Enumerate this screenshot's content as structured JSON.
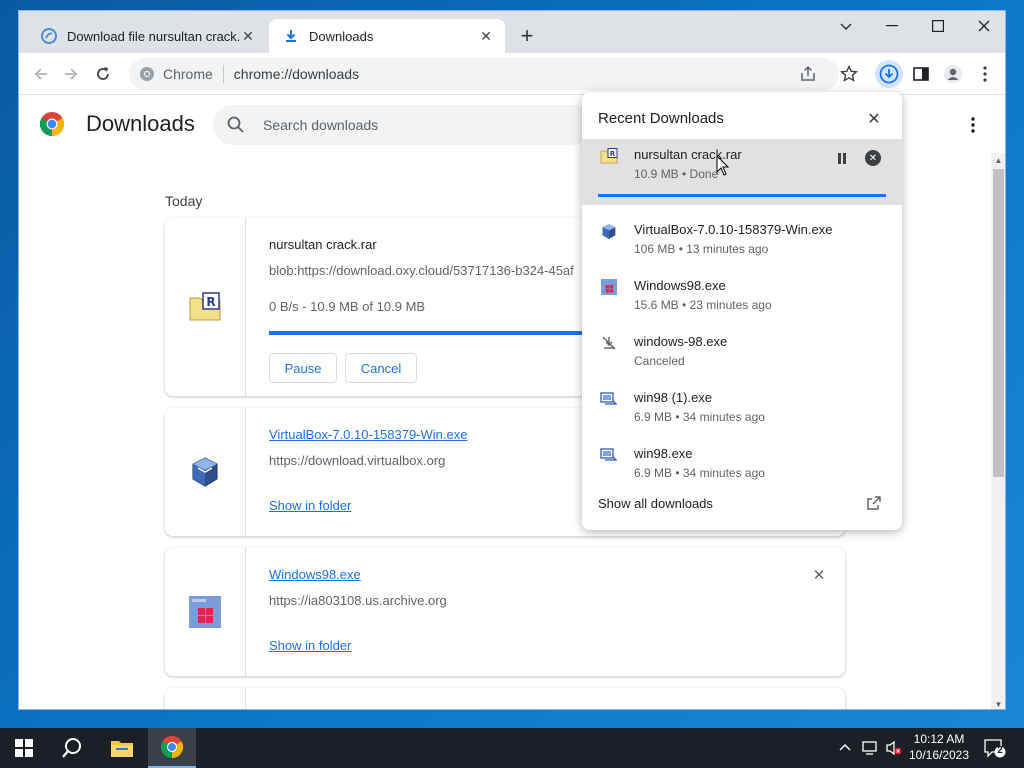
{
  "browser": {
    "tabs": [
      {
        "title": "Download file nursultan crack.ra",
        "active": false
      },
      {
        "title": "Downloads",
        "active": true
      }
    ],
    "new_tab_label": "+",
    "omnibox": {
      "site_label": "Chrome",
      "url": "chrome://downloads"
    }
  },
  "page": {
    "title": "Downloads",
    "search_placeholder": "Search downloads",
    "section_label": "Today",
    "items": [
      {
        "name": "nursultan crack.rar",
        "source": "blob:https://download.oxy.cloud/53717136-b324-45af",
        "status": "0 B/s - 10.9 MB of 10.9 MB",
        "progress_fraction": 1.0,
        "pause_label": "Pause",
        "cancel_label": "Cancel"
      },
      {
        "name": "VirtualBox-7.0.10-158379-Win.exe",
        "source": "https://download.virtualbox.org",
        "show_in_folder_label": "Show in folder"
      },
      {
        "name": "Windows98.exe",
        "source": "https://ia803108.us.archive.org",
        "show_in_folder_label": "Show in folder"
      }
    ]
  },
  "bubble": {
    "title": "Recent Downloads",
    "items": [
      {
        "name": "nursultan crack.rar",
        "meta": "10.9 MB • Done",
        "progress_fraction": 1.0
      },
      {
        "name": "VirtualBox-7.0.10-158379-Win.exe",
        "meta": "106 MB • 13 minutes ago"
      },
      {
        "name": "Windows98.exe",
        "meta": "15.6 MB • 23 minutes ago"
      },
      {
        "name": "windows-98.exe",
        "meta": "Canceled"
      },
      {
        "name": "win98 (1).exe",
        "meta": "6.9 MB • 34 minutes ago"
      },
      {
        "name": "win98.exe",
        "meta": "6.9 MB • 34 minutes ago"
      }
    ],
    "show_all_label": "Show all downloads"
  },
  "taskbar": {
    "time": "10:12 AM",
    "date": "10/16/2023",
    "notification_count": "2"
  },
  "colors": {
    "accent": "#1a73e8",
    "desktop": "#0b77c9",
    "taskbar": "#1b1f26"
  }
}
